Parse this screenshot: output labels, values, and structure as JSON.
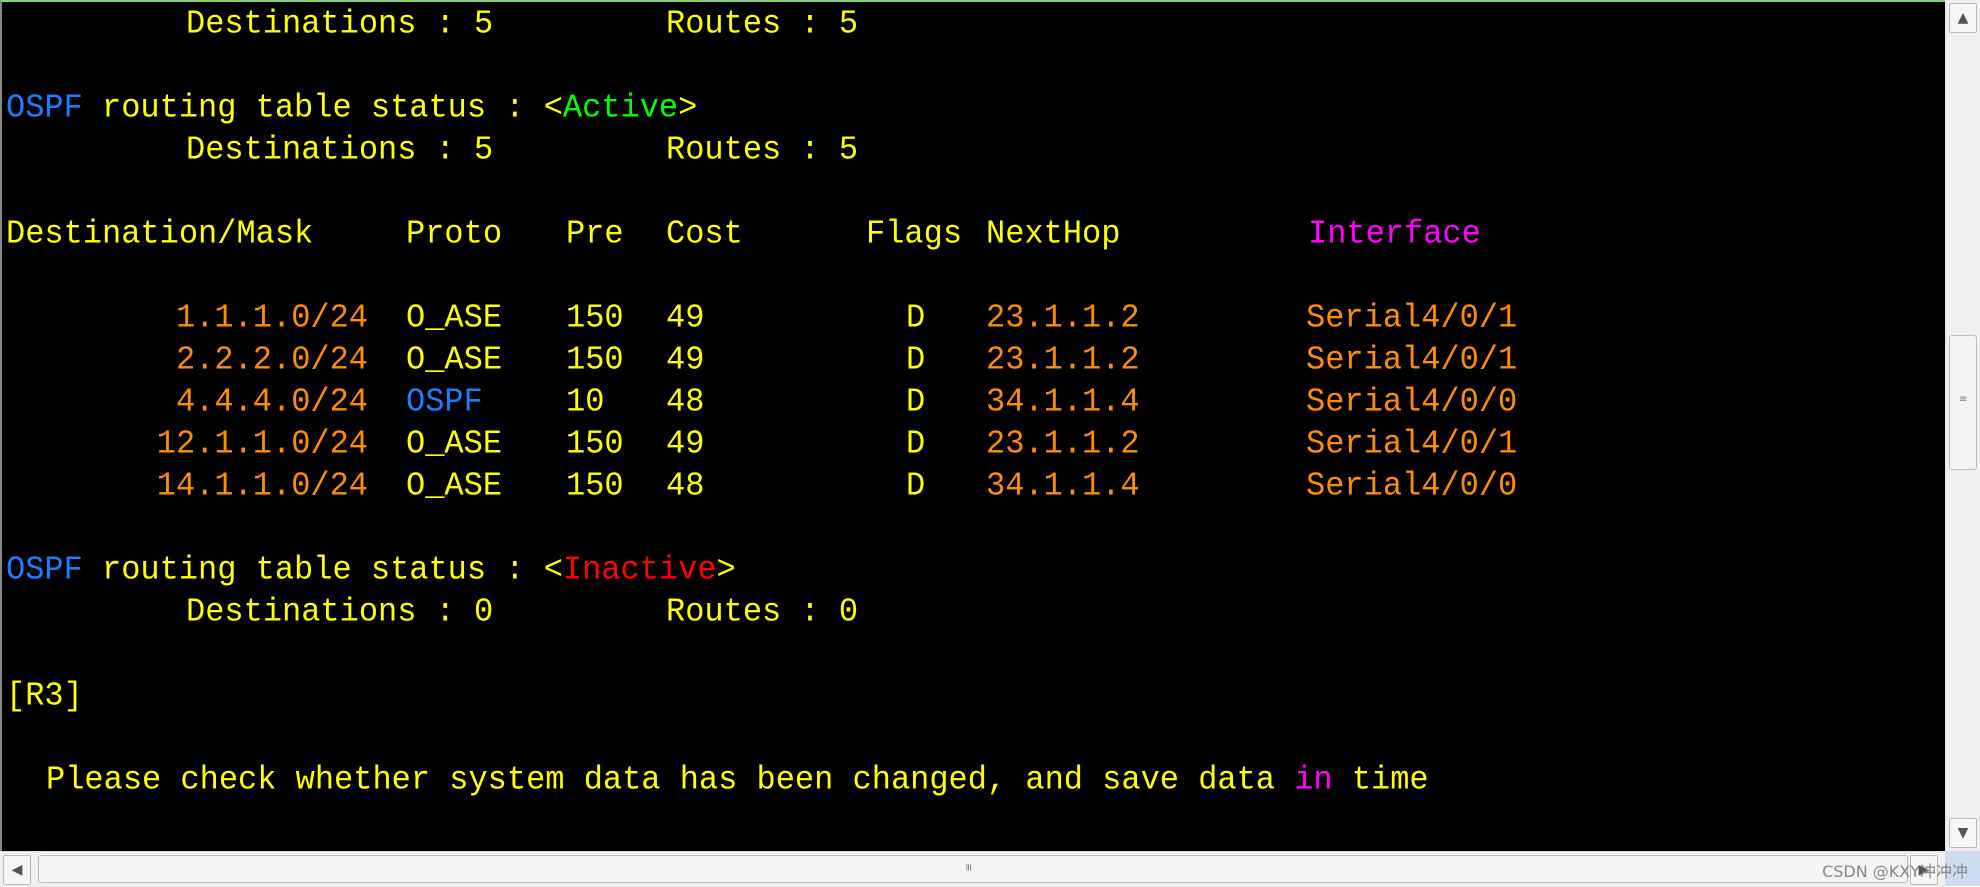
{
  "colors": {
    "text": "#ffff00",
    "protocol": "#1a7dff",
    "active": "#00ff00",
    "inactive": "#ff0000",
    "route_value": "#ff8c00",
    "highlight": "#ff00ff",
    "background": "#000000"
  },
  "summary_top": {
    "destinations_label": "Destinations : 5",
    "routes_label": "Routes : 5"
  },
  "active": {
    "proto": "OSPF",
    "text": " routing table status : ",
    "lt": "<",
    "status": "Active",
    "gt": ">",
    "destinations_label": "Destinations : 5",
    "routes_label": "Routes : 5"
  },
  "table": {
    "headers": {
      "dest": "Destination/Mask",
      "proto": "Proto",
      "pre": "Pre",
      "cost": "Cost",
      "flags": "Flags",
      "nexthop": "NextHop",
      "interface": "Interface"
    },
    "rows": [
      {
        "dest": "1.1.1.0/24",
        "proto": "O_ASE",
        "pre": "150",
        "cost": "49",
        "flags": "D",
        "nexthop": "23.1.1.2",
        "interface": "Serial4/0/1"
      },
      {
        "dest": "2.2.2.0/24",
        "proto": "O_ASE",
        "pre": "150",
        "cost": "49",
        "flags": "D",
        "nexthop": "23.1.1.2",
        "interface": "Serial4/0/1"
      },
      {
        "dest": "4.4.4.0/24",
        "proto": "OSPF",
        "pre": "10",
        "cost": "48",
        "flags": "D",
        "nexthop": "34.1.1.4",
        "interface": "Serial4/0/0"
      },
      {
        "dest": "12.1.1.0/24",
        "proto": "O_ASE",
        "pre": "150",
        "cost": "49",
        "flags": "D",
        "nexthop": "23.1.1.2",
        "interface": "Serial4/0/1"
      },
      {
        "dest": "14.1.1.0/24",
        "proto": "O_ASE",
        "pre": "150",
        "cost": "48",
        "flags": "D",
        "nexthop": "34.1.1.4",
        "interface": "Serial4/0/0"
      }
    ]
  },
  "inactive": {
    "proto": "OSPF",
    "text": " routing table status : ",
    "lt": "<",
    "status": "Inactive",
    "gt": ">",
    "destinations_label": "Destinations : 0",
    "routes_label": "Routes : 0"
  },
  "prompt": "[R3]",
  "notice": {
    "before": "Please check whether system data has been changed, and save data ",
    "highlight": "in",
    "after": " time"
  },
  "watermark": "CSDN @KXY冲冲冲"
}
